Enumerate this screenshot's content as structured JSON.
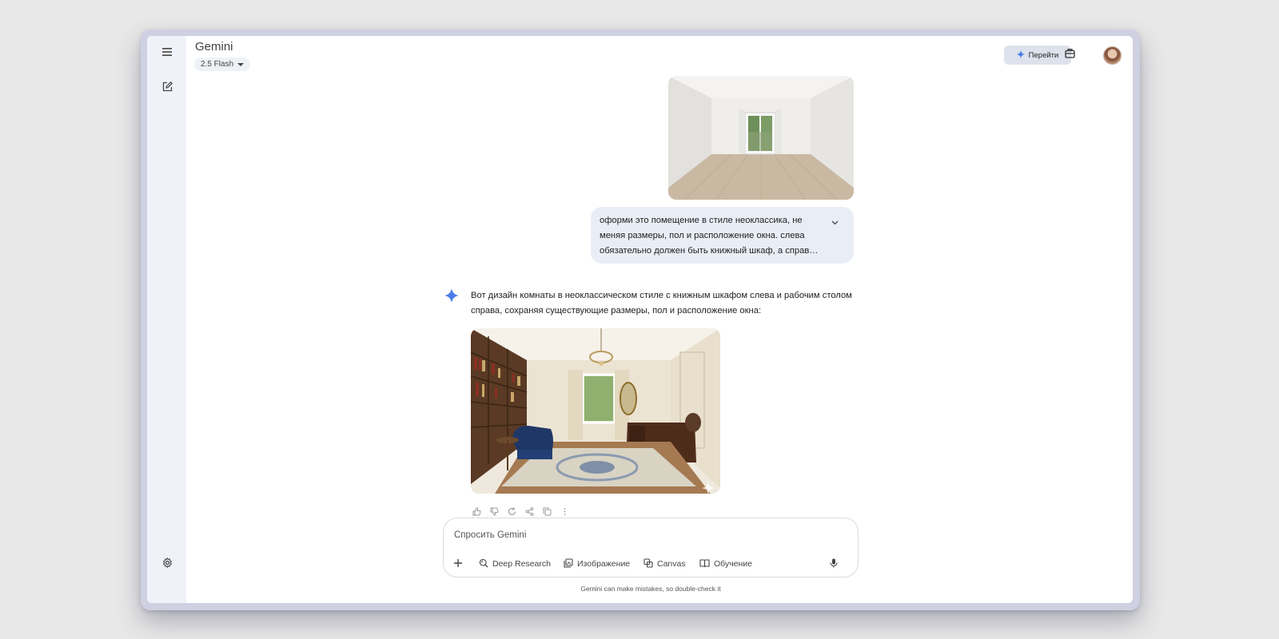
{
  "header": {
    "app_title": "Gemini",
    "model": "2.5 Flash",
    "upgrade_label": "Перейти"
  },
  "conversation": {
    "user_prompt": "оформи это помещение в стиле неоклассика, не меняя размеры, пол и расположение окна. слева обязательно должен быть книжный шкаф, а справа - рабочий стол",
    "response_text": "Вот дизайн комнаты в неоклассическом стиле с книжным шкафом слева и рабочим столом справа, сохраняя существующие размеры, пол и расположение окна:"
  },
  "composer": {
    "placeholder": "Спросить Gemini",
    "tools": [
      "Deep Research",
      "Изображение",
      "Canvas",
      "Обучение"
    ]
  },
  "footer": {
    "disclaimer": "Gemini can make mistakes, so double-check it"
  },
  "colors": {
    "rail_bg": "#eff2f9",
    "user_bubble": "#e9eef6",
    "gemini_spark": "#4a7de8",
    "upgrade_bg": "#dde2ec"
  },
  "icons": {
    "rail": [
      "menu-icon",
      "new-chat-icon",
      "settings-icon"
    ],
    "header": [
      "gemini-spark-icon",
      "briefcase-icon"
    ],
    "actions": [
      "thumbs-up-icon",
      "thumbs-down-icon",
      "regenerate-icon",
      "share-icon",
      "copy-icon",
      "more-icon"
    ]
  }
}
